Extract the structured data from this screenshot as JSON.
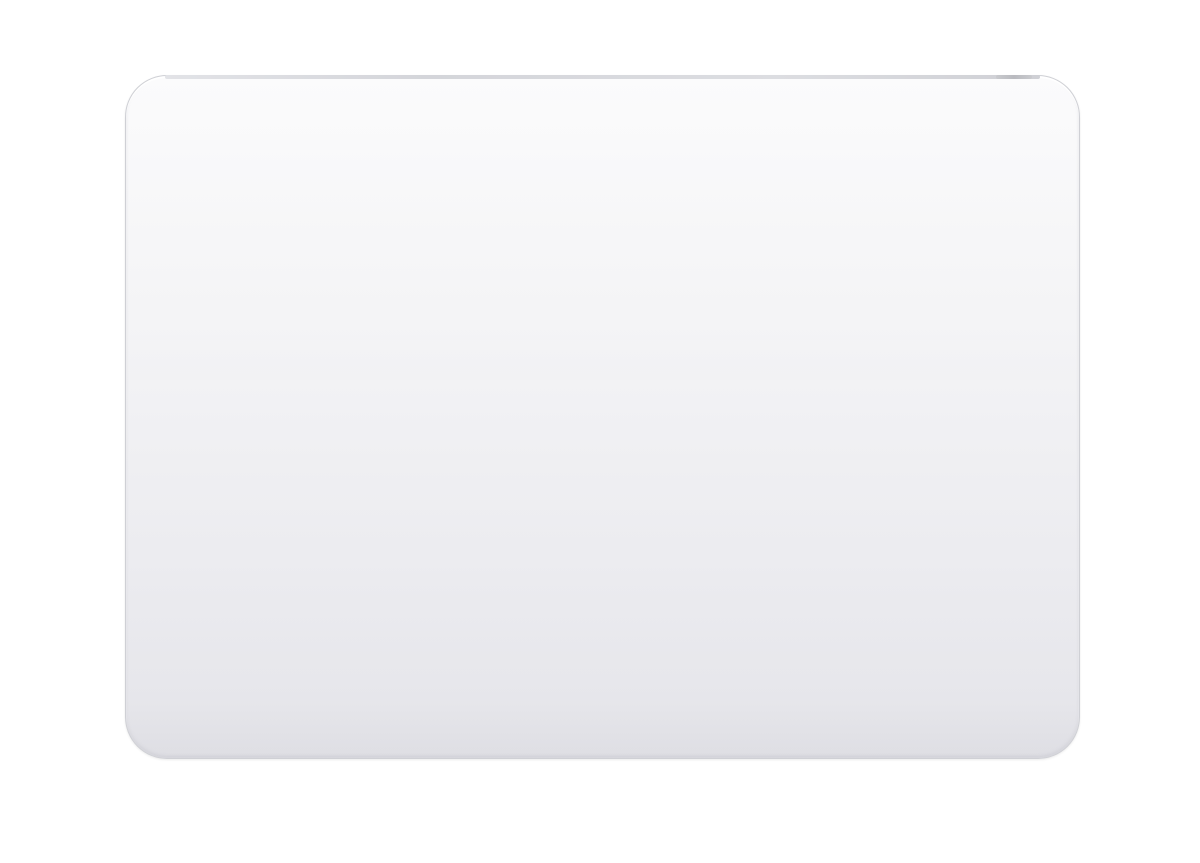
{
  "image": {
    "subject": "Magic Trackpad",
    "background_color": "#ffffff",
    "surface_colors": [
      "#fbfbfc",
      "#f4f4f6",
      "#ececf0",
      "#e4e4e9"
    ],
    "edge_color": "#cfd0d5"
  }
}
